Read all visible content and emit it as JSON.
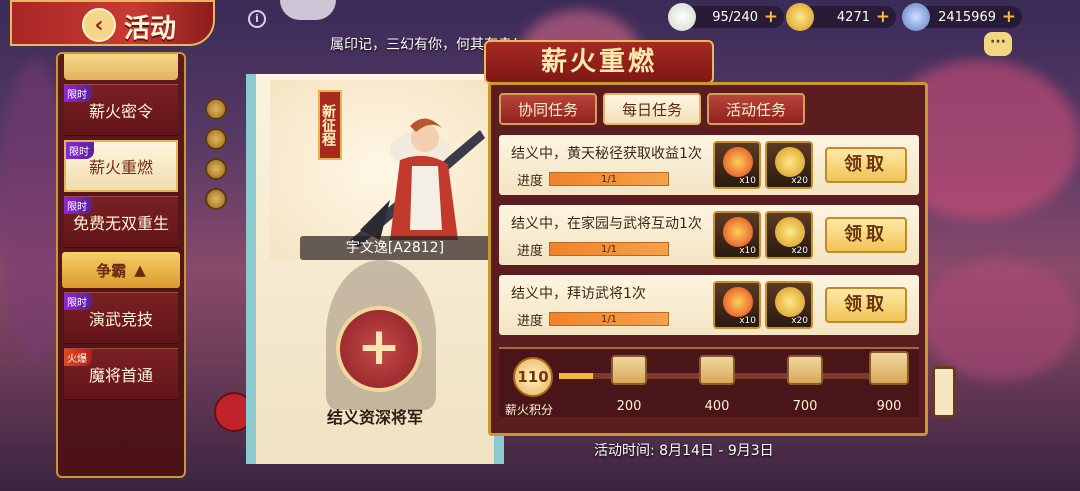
{
  "colors": {
    "accent": "#c93a32",
    "gold": "#e9b85a",
    "panel": "#5b1d20"
  },
  "header": {
    "title": "活动",
    "back_icon": "back-arrow-icon",
    "info_icon": "info-icon",
    "resources": [
      {
        "icon": "bun-icon",
        "value": "95/240"
      },
      {
        "icon": "gold-ingot-icon",
        "value": "4271"
      },
      {
        "icon": "coin-icon",
        "value": "2415969"
      }
    ],
    "chat_icon": "chat-bubble-icon"
  },
  "quote": "属印记，三幻有你，何其有幸！",
  "sidebar": {
    "items": [
      {
        "label": "薪火密令",
        "tag": "限时",
        "tag_type": "limited"
      },
      {
        "label": "薪火重燃",
        "tag": "限时",
        "tag_type": "limited",
        "active": true
      },
      {
        "label": "免费无双重生",
        "tag": "限时",
        "tag_type": "limited"
      }
    ],
    "group": {
      "label": "争霸",
      "icon": "caret-up-icon"
    },
    "group_items": [
      {
        "label": "演武竞技",
        "tag": "限时",
        "tag_type": "limited"
      },
      {
        "label": "魔将首通",
        "tag": "火爆",
        "tag_type": "hot"
      }
    ]
  },
  "hero": {
    "tag": "新征程",
    "name": "宇文逸[A2812]",
    "recruit_label": "结义资深将军",
    "add_icon": "plus-icon"
  },
  "panel": {
    "title": "薪火重燃",
    "tabs": [
      {
        "label": "协同任务",
        "active": false
      },
      {
        "label": "每日任务",
        "active": true
      },
      {
        "label": "活动任务",
        "active": false
      }
    ],
    "tasks": [
      {
        "title": "结义中，黄天秘径获取收益1次",
        "progress_label": "进度",
        "progress_text": "1/1",
        "progress": 1.0,
        "rewards": [
          {
            "icon": "flame-bowl-icon",
            "count": "x10"
          },
          {
            "icon": "gold-ingot-icon",
            "count": "x20"
          }
        ],
        "claim": "领取"
      },
      {
        "title": "结义中，在家园与武将互动1次",
        "progress_label": "进度",
        "progress_text": "1/1",
        "progress": 1.0,
        "rewards": [
          {
            "icon": "flame-bowl-icon",
            "count": "x10"
          },
          {
            "icon": "gold-ingot-icon",
            "count": "x20"
          }
        ],
        "claim": "领取"
      },
      {
        "title": "结义中，拜访武将1次",
        "progress_label": "进度",
        "progress_text": "1/1",
        "progress": 1.0,
        "rewards": [
          {
            "icon": "flame-bowl-icon",
            "count": "x10"
          },
          {
            "icon": "gold-ingot-icon",
            "count": "x20"
          }
        ],
        "claim": "领取"
      }
    ],
    "score": {
      "value": "110",
      "label": "薪火积分",
      "progress": 0.1,
      "milestones": [
        "200",
        "400",
        "700",
        "900"
      ]
    }
  },
  "event_time": "活动时间:  8月14日 - 9月3日"
}
